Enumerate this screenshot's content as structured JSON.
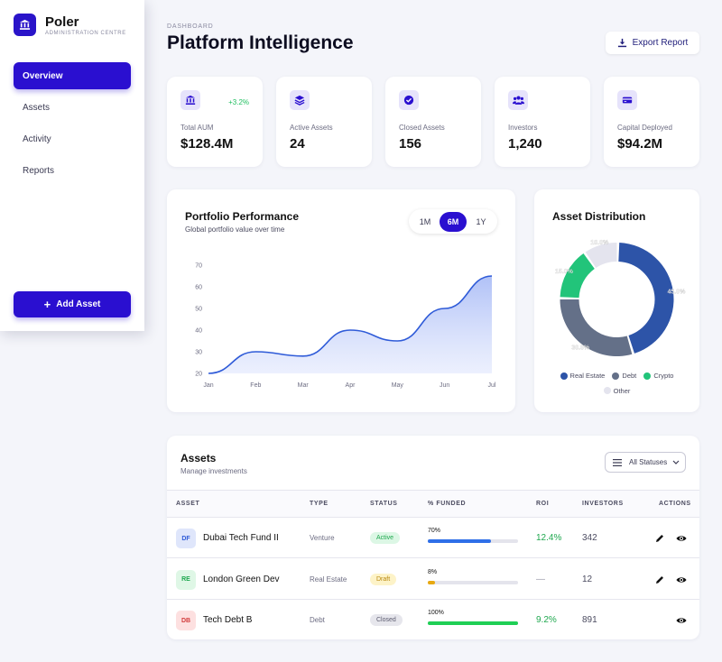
{
  "brand": {
    "name": "Poler",
    "subtitle": "ADMINISTRATION CENTRE"
  },
  "sidebar": {
    "items": [
      {
        "label": "Overview",
        "active": true
      },
      {
        "label": "Assets",
        "active": false
      },
      {
        "label": "Activity",
        "active": false
      },
      {
        "label": "Reports",
        "active": false
      }
    ],
    "add_button": "Add Asset"
  },
  "header": {
    "breadcrumb": "DASHBOARD",
    "title": "Platform Intelligence",
    "export_label": "Export Report"
  },
  "stats": [
    {
      "label": "Total AUM",
      "value": "$128.4M",
      "change": "+3.2%",
      "icon": "bank-icon"
    },
    {
      "label": "Active Assets",
      "value": "24",
      "change": "",
      "icon": "layers-icon"
    },
    {
      "label": "Closed Assets",
      "value": "156",
      "change": "",
      "icon": "check-badge-icon"
    },
    {
      "label": "Investors",
      "value": "1,240",
      "change": "",
      "icon": "users-icon"
    },
    {
      "label": "Capital Deployed",
      "value": "$94.2M",
      "change": "",
      "icon": "credit-card-icon"
    }
  ],
  "performance": {
    "title": "Portfolio Performance",
    "subtitle": "Global portfolio value over time",
    "ranges": [
      {
        "label": "1M",
        "active": false
      },
      {
        "label": "6M",
        "active": true
      },
      {
        "label": "1Y",
        "active": false
      }
    ]
  },
  "distribution": {
    "title": "Asset Distribution"
  },
  "chart_data": [
    {
      "type": "area",
      "x": [
        "Jan",
        "Feb",
        "Mar",
        "Apr",
        "May",
        "Jun",
        "Jul"
      ],
      "values": [
        20,
        30,
        28,
        40,
        35,
        50,
        65
      ],
      "ylim": [
        20,
        70
      ],
      "yticks": [
        20,
        30,
        40,
        50,
        60,
        70
      ],
      "grid": false,
      "color": "#2f5bd8"
    },
    {
      "type": "pie",
      "donut": true,
      "categories": [
        "Real Estate",
        "Debt",
        "Crypto",
        "Other"
      ],
      "values": [
        45,
        30,
        15,
        10
      ],
      "labels": [
        "45.0%",
        "30.0%",
        "15.0%",
        "10.0%"
      ],
      "colors": [
        "#2d54a8",
        "#647088",
        "#22c47a",
        "#e4e4ee"
      ],
      "legend": "bottom"
    }
  ],
  "assets": {
    "title": "Assets",
    "subtitle": "Manage investments",
    "filter_label": "All Statuses",
    "columns": [
      "ASSET",
      "TYPE",
      "STATUS",
      "% FUNDED",
      "ROI",
      "INVESTORS",
      "ACTIONS"
    ],
    "rows": [
      {
        "initials": "DF",
        "name": "Dubai Tech Fund II",
        "type": "Venture",
        "status": "Active",
        "funded_label": "70%",
        "funded": 70,
        "roi": "12.4%",
        "investors": "342",
        "editable": true,
        "badge_bg": "#dfe6fb",
        "badge_fg": "#2f5bd8",
        "status_bg": "#dcf7e5",
        "status_fg": "#1fa84f",
        "bar_color": "#2f6fe8"
      },
      {
        "initials": "RE",
        "name": "London Green Dev",
        "type": "Real Estate",
        "status": "Draft",
        "funded_label": "8%",
        "funded": 8,
        "roi": "—",
        "investors": "12",
        "editable": true,
        "badge_bg": "#dff7e6",
        "badge_fg": "#1fa84f",
        "status_bg": "#fdf3c8",
        "status_fg": "#b8860b",
        "bar_color": "#e8a911"
      },
      {
        "initials": "DB",
        "name": "Tech Debt B",
        "type": "Debt",
        "status": "Closed",
        "funded_label": "100%",
        "funded": 100,
        "roi": "9.2%",
        "investors": "891",
        "editable": false,
        "badge_bg": "#fde0e0",
        "badge_fg": "#d23b3b",
        "status_bg": "#e6e6ec",
        "status_fg": "#5a5a6e",
        "bar_color": "#1fcf55"
      }
    ]
  }
}
